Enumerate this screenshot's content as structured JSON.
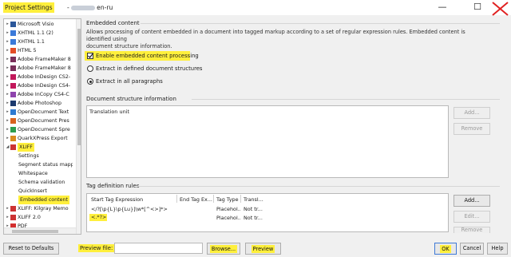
{
  "window": {
    "title": "Project Settings",
    "title_suffix": "en-ru",
    "minimize_label": "—",
    "maximize_label": "☐",
    "close_label": "✕"
  },
  "tree": [
    {
      "label": "Microsoft Visio",
      "icon_color": "#2b579a",
      "arrow": "▸"
    },
    {
      "label": "XHTML 1.1 (2)",
      "icon_color": "#3b7ad9",
      "arrow": "▸"
    },
    {
      "label": "XHTML 1.1",
      "icon_color": "#3b7ad9",
      "arrow": "▸"
    },
    {
      "label": "HTML 5",
      "icon_color": "#e44d26",
      "arrow": "▸"
    },
    {
      "label": "Adobe FrameMaker 8",
      "icon_color": "#7a2f5a",
      "arrow": "▸"
    },
    {
      "label": "Adobe FrameMaker 8",
      "icon_color": "#7a2f5a",
      "arrow": "▸"
    },
    {
      "label": "Adobe InDesign CS2-",
      "icon_color": "#c2185b",
      "arrow": "▸"
    },
    {
      "label": "Adobe InDesign CS4-",
      "icon_color": "#c2185b",
      "arrow": "▸"
    },
    {
      "label": "Adobe InCopy CS4-C",
      "icon_color": "#8e44ad",
      "arrow": "▸"
    },
    {
      "label": "Adobe Photoshop",
      "icon_color": "#1c3a6e",
      "arrow": "▸"
    },
    {
      "label": "OpenDocument Text",
      "icon_color": "#2f7bd1",
      "arrow": "▸"
    },
    {
      "label": "OpenDocument Pres",
      "icon_color": "#d9631f",
      "arrow": "▸"
    },
    {
      "label": "OpenDocument Spre",
      "icon_color": "#2e9e4e",
      "arrow": "▸"
    },
    {
      "label": "QuarkXPress Export",
      "icon_color": "#d98c1f",
      "arrow": "▸"
    },
    {
      "label": "XLIFF",
      "icon_color": "#cc3333",
      "arrow": "◢",
      "highlight": true
    },
    {
      "label": "Settings",
      "child": true
    },
    {
      "label": "Segment status mapp",
      "child": true
    },
    {
      "label": "Whitespace",
      "child": true
    },
    {
      "label": "Schema validation",
      "child": true
    },
    {
      "label": "QuickInsert",
      "child": true
    },
    {
      "label": "Embedded content",
      "child": true,
      "highlight": true,
      "selected": true
    },
    {
      "label": "XLIFF: Kilgray Memo",
      "icon_color": "#cc3333",
      "arrow": "▸"
    },
    {
      "label": "XLIFF 2.0",
      "icon_color": "#cc3333",
      "arrow": "▸"
    },
    {
      "label": "PDF",
      "icon_color": "#d32f2f",
      "arrow": "▸"
    }
  ],
  "embedded": {
    "section_title": "Embedded content",
    "description_line1": "Allows processing of content embedded in a document into tagged markup according to a set of regular expression rules. Embedded content is identified using",
    "description_line2": "document structure information.",
    "enable_label": "Enable embedded content processing",
    "enable_checked": true,
    "radio_defined_label": "Extract in defined document structures",
    "radio_all_label": "Extract in all paragraphs",
    "selected_radio": "all"
  },
  "doc_structure": {
    "section_title": "Document structure information",
    "items": [
      "Translation unit"
    ],
    "add_label": "Add...",
    "remove_label": "Remove"
  },
  "tag_rules": {
    "section_title": "Tag definition rules",
    "columns": [
      "Start Tag Expression",
      "End Tag Ex...",
      "Tag Type",
      "Transl..."
    ],
    "rows": [
      {
        "start": "</?[\\p{L}\\p{Lu}]\\w*[^<>]*>",
        "end": "",
        "type": "Placehol...",
        "transl": "Not tr...",
        "highlight": false
      },
      {
        "start": "<.*?>",
        "end": "",
        "type": "Placehol...",
        "transl": "Not tr...",
        "highlight": true
      }
    ],
    "add_label": "Add...",
    "edit_label": "Edit...",
    "remove_label": "Remove"
  },
  "footer": {
    "reset_label": "Reset to Defaults",
    "preview_file_label": "Preview file:",
    "preview_file_value": "",
    "browse_label": "Browse...",
    "preview_label": "Preview",
    "ok_label": "OK",
    "cancel_label": "Cancel",
    "help_label": "Help"
  },
  "colors": {
    "highlight": "#ffef3c",
    "accent_border": "#3f7ad6",
    "annotation_red": "#e02020"
  }
}
